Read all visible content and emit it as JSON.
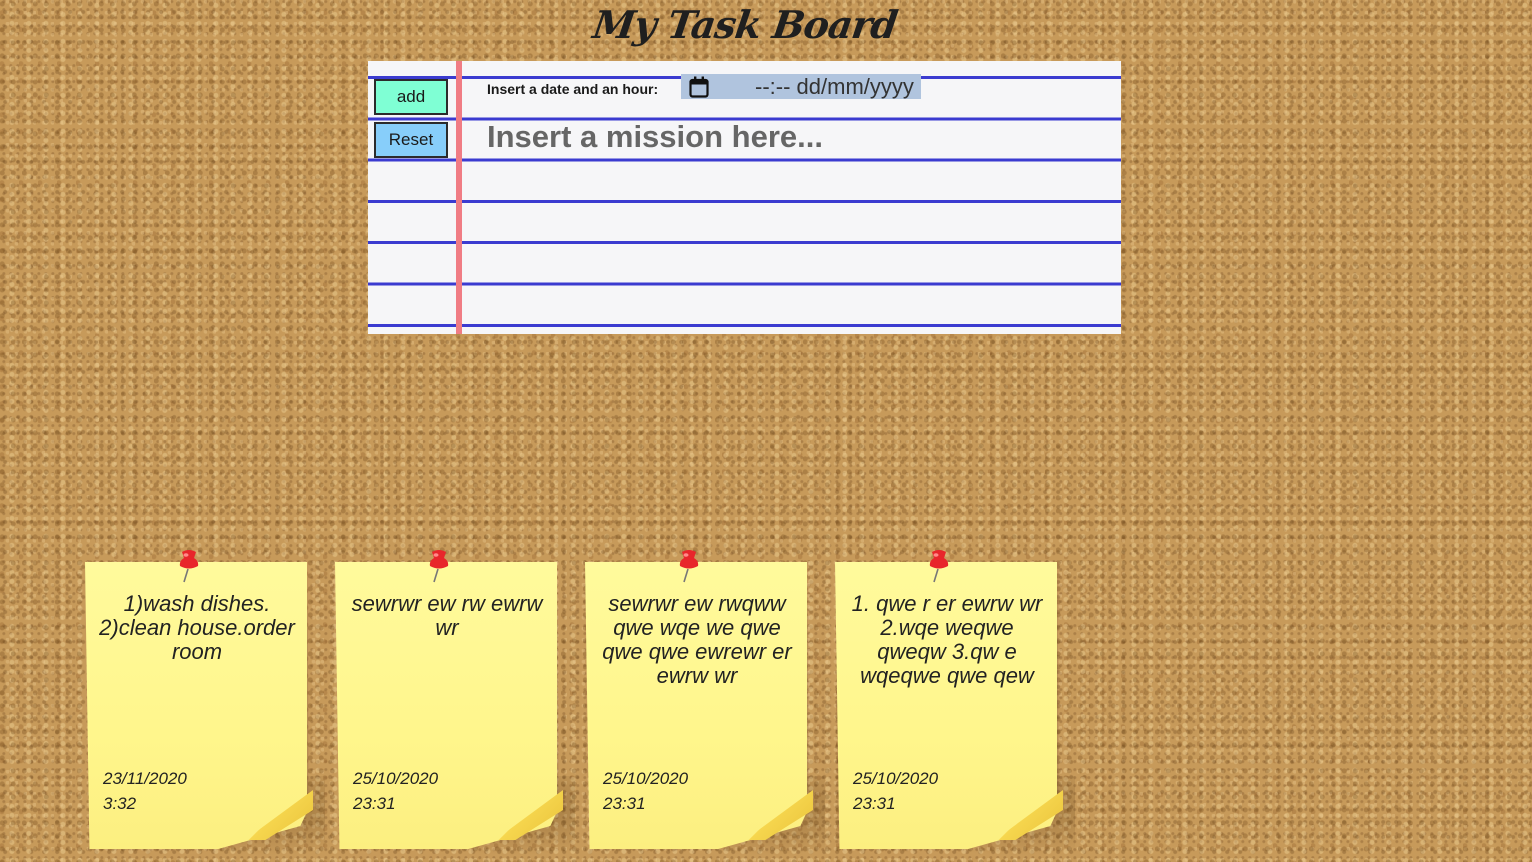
{
  "header": {
    "title": "My Task Board"
  },
  "form": {
    "add_label": "add",
    "reset_label": "Reset",
    "date_label": "Insert a date and an hour:",
    "date_value": "--:-- dd/mm/yyyy",
    "mission_placeholder": "Insert a mission here..."
  },
  "colors": {
    "add_button": "#7fffd4",
    "reset_button": "#87cefa",
    "date_input_bg": "#b0c4de",
    "note": "#fff68c",
    "pin": "#e8262b",
    "rule_line": "#3b3bd0",
    "margin_line": "#f07c84"
  },
  "notes": [
    {
      "text": "1)wash dishes. 2)clean house.order room",
      "date": "23/11/2020",
      "time": "3:32"
    },
    {
      "text": "sewrwr ew rw ewrw wr",
      "date": "25/10/2020",
      "time": "23:31"
    },
    {
      "text": "sewrwr ew rwqww qwe wqe we qwe qwe qwe ewrewr er ewrw wr",
      "date": "25/10/2020",
      "time": "23:31"
    },
    {
      "text": "1. qwe r er ewrw wr 2.wqe weqwe qweqw 3.qw e wqeqwe qwe qew",
      "date": "25/10/2020",
      "time": "23:31"
    }
  ]
}
